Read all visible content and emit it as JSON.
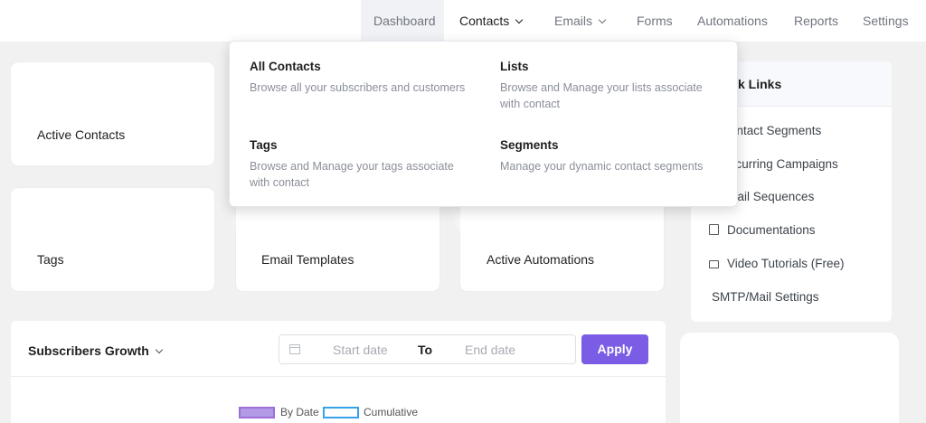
{
  "nav": {
    "items": [
      {
        "label": "Dashboard"
      },
      {
        "label": "Contacts"
      },
      {
        "label": "Emails"
      },
      {
        "label": "Forms"
      },
      {
        "label": "Automations"
      },
      {
        "label": "Reports"
      },
      {
        "label": "Settings"
      }
    ]
  },
  "dropdown": {
    "items": [
      {
        "title": "All Contacts",
        "description": "Browse all your subscribers and customers"
      },
      {
        "title": "Lists",
        "description": "Browse and Manage your lists associate with contact"
      },
      {
        "title": "Tags",
        "description": "Browse and Manage your tags associate with contact"
      },
      {
        "title": "Segments",
        "description": "Manage your dynamic contact segments"
      }
    ]
  },
  "stats": {
    "cards": [
      {
        "label": "Active Contacts"
      },
      {
        "label": "Tags"
      },
      {
        "label": "Email Templates"
      },
      {
        "label": "Active Automations"
      }
    ]
  },
  "quick_links": {
    "title_visible": "k Links",
    "items": [
      {
        "label": "ontact Segments",
        "icon": ""
      },
      {
        "label": "ecurring Campaigns",
        "icon": ""
      },
      {
        "label": "nail Sequences",
        "icon": ""
      },
      {
        "label": "Documentations",
        "icon": "document-icon"
      },
      {
        "label": "Video Tutorials (Free)",
        "icon": "video-icon"
      },
      {
        "label": "SMTP/Mail Settings",
        "icon": ""
      }
    ]
  },
  "growth": {
    "title": "Subscribers Growth",
    "start_placeholder": "Start date",
    "to_label": "To",
    "end_placeholder": "End date",
    "apply_label": "Apply",
    "legend": [
      {
        "name": "By Date",
        "color": "#9b6fd6"
      },
      {
        "name": "Cumulative",
        "color": "#36a2eb"
      }
    ]
  },
  "colors": {
    "accent": "#7b5ce5"
  }
}
